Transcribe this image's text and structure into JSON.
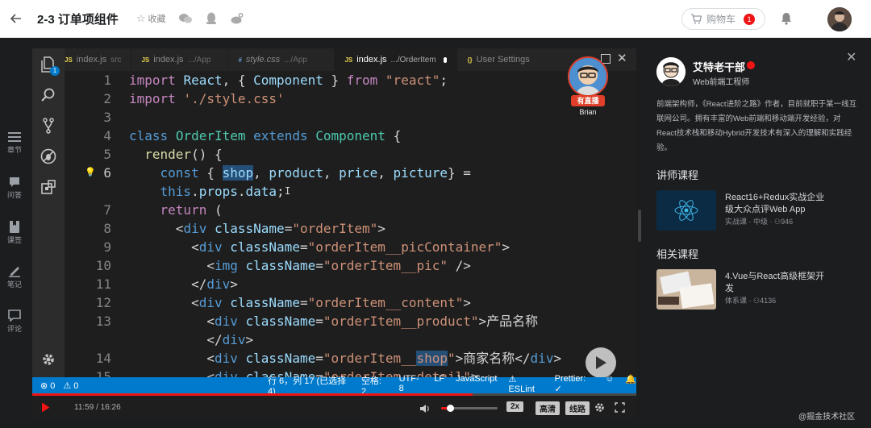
{
  "header": {
    "course_title": "2-3 订单项组件",
    "favorite_label": "收藏",
    "cart_label": "购物车",
    "cart_count": "1"
  },
  "left_nav": [
    {
      "label": "章节",
      "icon": "menu-icon"
    },
    {
      "label": "问答",
      "icon": "qa-icon"
    },
    {
      "label": "课签",
      "icon": "bookmark-icon"
    },
    {
      "label": "笔记",
      "icon": "note-icon"
    },
    {
      "label": "评论",
      "icon": "comment-icon"
    }
  ],
  "editor": {
    "tabs": [
      {
        "icon": "JS",
        "name": "index.js",
        "dir": "src"
      },
      {
        "icon": "JS",
        "name": "index.js",
        "dir": ".../App"
      },
      {
        "icon": "#",
        "name": "style.css",
        "dir": ".../App"
      },
      {
        "icon": "JS",
        "name": "index.js",
        "dir": ".../OrderItem"
      },
      {
        "icon": "{}",
        "name": "User Settings",
        "dir": ""
      }
    ],
    "line_numbers": [
      "1",
      "2",
      "3",
      "4",
      "5",
      "6",
      "",
      "7",
      "8",
      "9",
      "10",
      "11",
      "12",
      "13",
      "",
      "14",
      "15"
    ],
    "notification_count": "1",
    "status_left": [
      "⊗ 0",
      "⚠ 0"
    ],
    "status_right": [
      "行 6，列 17 (已选择4)",
      "空格: 2",
      "UTF-8",
      "LF",
      "JavaScript",
      "⚠ ESLint",
      "Prettier: ✓"
    ]
  },
  "presenter": {
    "badge": "有直播",
    "name": "Brian"
  },
  "player": {
    "current_time": "11:59",
    "duration": "16:26",
    "progress_fraction": 0.729,
    "volume_fraction": 0.15,
    "speed_label": "2x",
    "quality_label": "高清",
    "route_label": "线路"
  },
  "teacher": {
    "name": "艾特老干部",
    "title": "Web前端工程师",
    "description": "前端架构师，《React进阶之路》作者，目前就职于某一线互联网公司。拥有丰富的Web前端和移动端开发经验，对React技术栈和移动Hybrid开发技术有深入的理解和实践经验。"
  },
  "teacher_courses_heading": "讲师课程",
  "teacher_courses": [
    {
      "name": "React16+Redux实战企业级大众点评Web App",
      "meta": "实战课 · 中级 · ⚇946"
    }
  ],
  "related_heading": "相关课程",
  "related_courses": [
    {
      "name": "4.Vue与React高级框架开发",
      "meta": "体系课 · ⚇4136"
    }
  ],
  "watermark": "@掘金技术社区",
  "colors": {
    "accent": "#f01414",
    "statusbar": "#007acc"
  }
}
